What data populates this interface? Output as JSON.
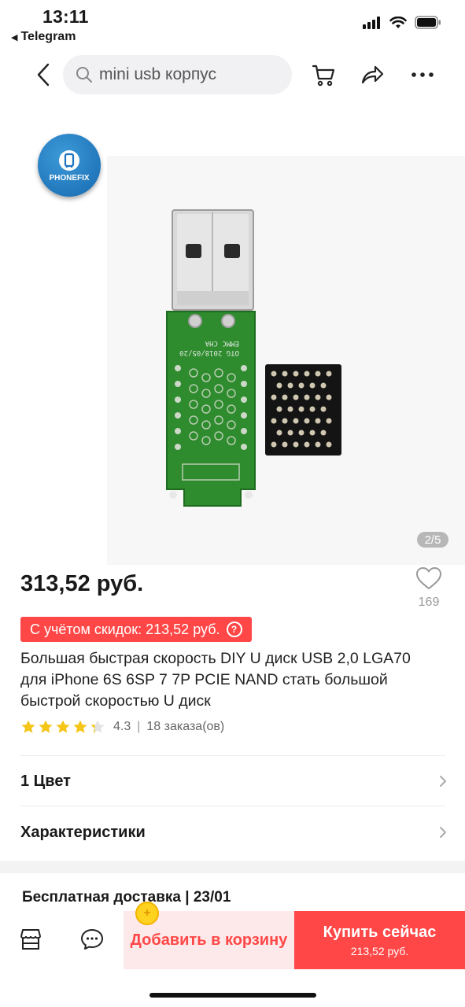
{
  "status_bar": {
    "time": "13:11",
    "back_app": "Telegram",
    "icons": [
      "signal-icon",
      "wifi-icon",
      "battery-icon"
    ]
  },
  "nav": {
    "search_text": "mini usb корпус",
    "icons": [
      "back-icon",
      "search-icon",
      "cart-icon",
      "share-icon",
      "more-icon"
    ]
  },
  "gallery": {
    "logo_text": "PHONEFIX",
    "counter": "2/5",
    "pcb_text": [
      "OTG",
      "2018/05/20",
      "EMMC",
      "CHA"
    ]
  },
  "product": {
    "price": "313,52 руб.",
    "wishlist_count": "169",
    "discount_label": "С учётом скидок: 213,52 руб.",
    "discount_help": "?",
    "title": "Большая быстрая скорость DIY U диск USB 2,0 LGA70 для iPhone 6S 6SP 7 7P PCIE NAND стать большой быстрой скоростью U диск",
    "rating_value": 4.3,
    "rating": "4.3",
    "orders": "18 заказа(ов)"
  },
  "options": {
    "color_row": "1 Цвет",
    "specs_row": "Характеристики"
  },
  "shipping": {
    "text": "Бесплатная доставка | 23/01"
  },
  "bottom_bar": {
    "coin_icon": "+",
    "add_to_cart": "Добавить в корзину",
    "buy_now": "Купить сейчас",
    "buy_price": "213,52 руб."
  },
  "colors": {
    "accent": "#ff4747",
    "cart_bg": "#fde9ea",
    "pcb_green": "#2e8b2e",
    "star": "#f5c518"
  }
}
